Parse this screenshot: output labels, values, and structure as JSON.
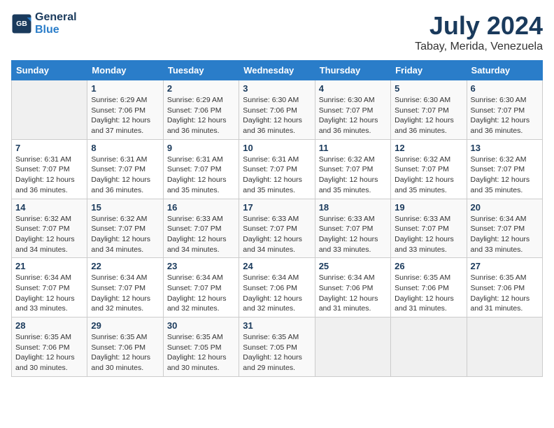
{
  "logo": {
    "line1": "General",
    "line2": "Blue"
  },
  "title": "July 2024",
  "subtitle": "Tabay, Merida, Venezuela",
  "weekdays": [
    "Sunday",
    "Monday",
    "Tuesday",
    "Wednesday",
    "Thursday",
    "Friday",
    "Saturday"
  ],
  "weeks": [
    [
      {
        "day": "",
        "info": ""
      },
      {
        "day": "1",
        "info": "Sunrise: 6:29 AM\nSunset: 7:06 PM\nDaylight: 12 hours\nand 37 minutes."
      },
      {
        "day": "2",
        "info": "Sunrise: 6:29 AM\nSunset: 7:06 PM\nDaylight: 12 hours\nand 36 minutes."
      },
      {
        "day": "3",
        "info": "Sunrise: 6:30 AM\nSunset: 7:06 PM\nDaylight: 12 hours\nand 36 minutes."
      },
      {
        "day": "4",
        "info": "Sunrise: 6:30 AM\nSunset: 7:07 PM\nDaylight: 12 hours\nand 36 minutes."
      },
      {
        "day": "5",
        "info": "Sunrise: 6:30 AM\nSunset: 7:07 PM\nDaylight: 12 hours\nand 36 minutes."
      },
      {
        "day": "6",
        "info": "Sunrise: 6:30 AM\nSunset: 7:07 PM\nDaylight: 12 hours\nand 36 minutes."
      }
    ],
    [
      {
        "day": "7",
        "info": "Sunrise: 6:31 AM\nSunset: 7:07 PM\nDaylight: 12 hours\nand 36 minutes."
      },
      {
        "day": "8",
        "info": "Sunrise: 6:31 AM\nSunset: 7:07 PM\nDaylight: 12 hours\nand 36 minutes."
      },
      {
        "day": "9",
        "info": "Sunrise: 6:31 AM\nSunset: 7:07 PM\nDaylight: 12 hours\nand 35 minutes."
      },
      {
        "day": "10",
        "info": "Sunrise: 6:31 AM\nSunset: 7:07 PM\nDaylight: 12 hours\nand 35 minutes."
      },
      {
        "day": "11",
        "info": "Sunrise: 6:32 AM\nSunset: 7:07 PM\nDaylight: 12 hours\nand 35 minutes."
      },
      {
        "day": "12",
        "info": "Sunrise: 6:32 AM\nSunset: 7:07 PM\nDaylight: 12 hours\nand 35 minutes."
      },
      {
        "day": "13",
        "info": "Sunrise: 6:32 AM\nSunset: 7:07 PM\nDaylight: 12 hours\nand 35 minutes."
      }
    ],
    [
      {
        "day": "14",
        "info": "Sunrise: 6:32 AM\nSunset: 7:07 PM\nDaylight: 12 hours\nand 34 minutes."
      },
      {
        "day": "15",
        "info": "Sunrise: 6:32 AM\nSunset: 7:07 PM\nDaylight: 12 hours\nand 34 minutes."
      },
      {
        "day": "16",
        "info": "Sunrise: 6:33 AM\nSunset: 7:07 PM\nDaylight: 12 hours\nand 34 minutes."
      },
      {
        "day": "17",
        "info": "Sunrise: 6:33 AM\nSunset: 7:07 PM\nDaylight: 12 hours\nand 34 minutes."
      },
      {
        "day": "18",
        "info": "Sunrise: 6:33 AM\nSunset: 7:07 PM\nDaylight: 12 hours\nand 33 minutes."
      },
      {
        "day": "19",
        "info": "Sunrise: 6:33 AM\nSunset: 7:07 PM\nDaylight: 12 hours\nand 33 minutes."
      },
      {
        "day": "20",
        "info": "Sunrise: 6:34 AM\nSunset: 7:07 PM\nDaylight: 12 hours\nand 33 minutes."
      }
    ],
    [
      {
        "day": "21",
        "info": "Sunrise: 6:34 AM\nSunset: 7:07 PM\nDaylight: 12 hours\nand 33 minutes."
      },
      {
        "day": "22",
        "info": "Sunrise: 6:34 AM\nSunset: 7:07 PM\nDaylight: 12 hours\nand 32 minutes."
      },
      {
        "day": "23",
        "info": "Sunrise: 6:34 AM\nSunset: 7:07 PM\nDaylight: 12 hours\nand 32 minutes."
      },
      {
        "day": "24",
        "info": "Sunrise: 6:34 AM\nSunset: 7:06 PM\nDaylight: 12 hours\nand 32 minutes."
      },
      {
        "day": "25",
        "info": "Sunrise: 6:34 AM\nSunset: 7:06 PM\nDaylight: 12 hours\nand 31 minutes."
      },
      {
        "day": "26",
        "info": "Sunrise: 6:35 AM\nSunset: 7:06 PM\nDaylight: 12 hours\nand 31 minutes."
      },
      {
        "day": "27",
        "info": "Sunrise: 6:35 AM\nSunset: 7:06 PM\nDaylight: 12 hours\nand 31 minutes."
      }
    ],
    [
      {
        "day": "28",
        "info": "Sunrise: 6:35 AM\nSunset: 7:06 PM\nDaylight: 12 hours\nand 30 minutes."
      },
      {
        "day": "29",
        "info": "Sunrise: 6:35 AM\nSunset: 7:06 PM\nDaylight: 12 hours\nand 30 minutes."
      },
      {
        "day": "30",
        "info": "Sunrise: 6:35 AM\nSunset: 7:05 PM\nDaylight: 12 hours\nand 30 minutes."
      },
      {
        "day": "31",
        "info": "Sunrise: 6:35 AM\nSunset: 7:05 PM\nDaylight: 12 hours\nand 29 minutes."
      },
      {
        "day": "",
        "info": ""
      },
      {
        "day": "",
        "info": ""
      },
      {
        "day": "",
        "info": ""
      }
    ]
  ]
}
